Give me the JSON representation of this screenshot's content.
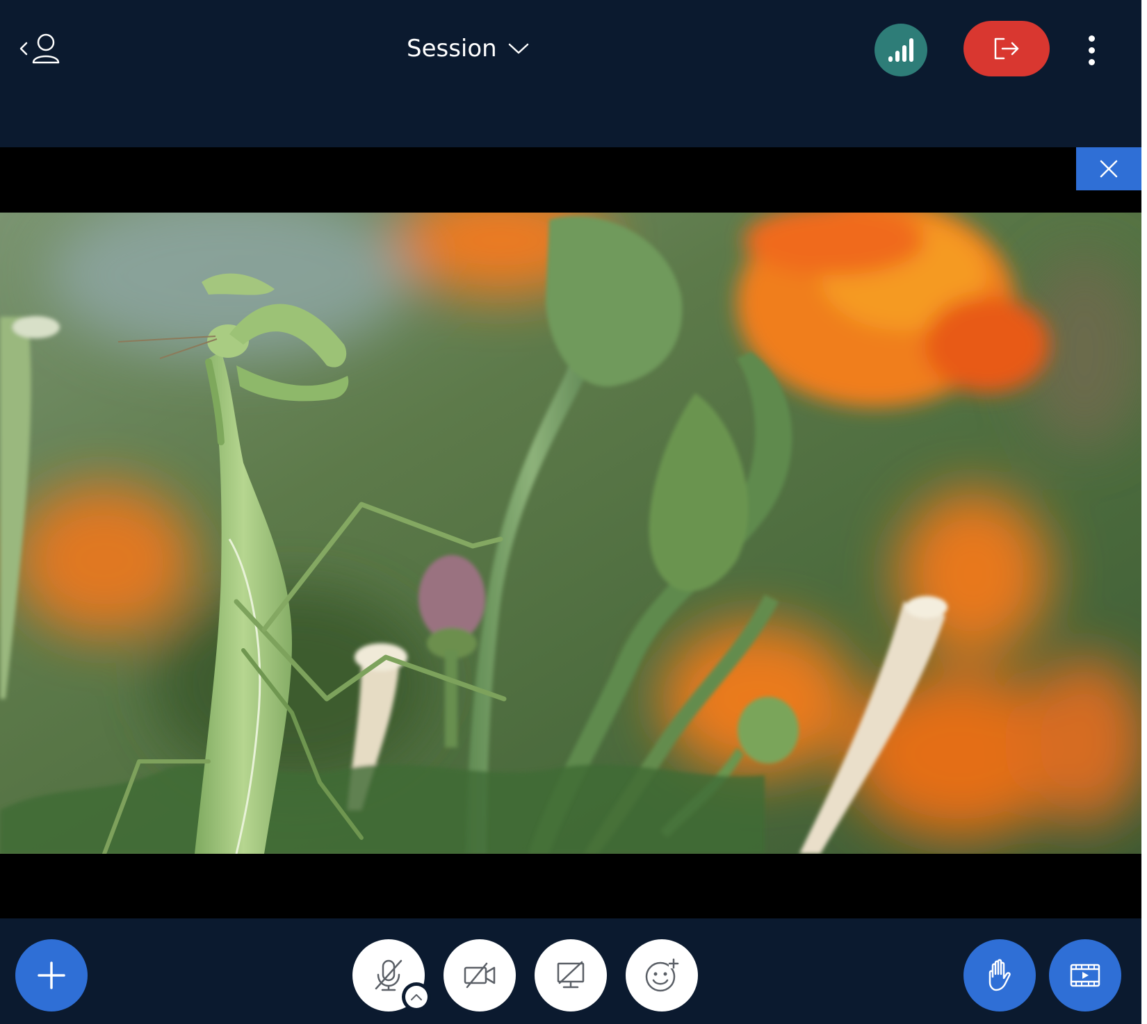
{
  "header": {
    "session_title": "Session"
  },
  "icons": {
    "user": "user-back-icon",
    "session_dropdown": "chevron-down-icon",
    "connection": "signal-bars-icon",
    "leave": "leave-session-icon",
    "more": "more-vertical-icon",
    "close_video": "close-icon",
    "add": "plus-icon",
    "mic": "mic-muted-icon",
    "mic_options": "chevron-up-icon",
    "camera": "camera-off-icon",
    "screen_share": "screen-share-off-icon",
    "reactions": "emoji-add-icon",
    "raise_hand": "hand-icon",
    "share_video": "video-player-icon"
  },
  "colors": {
    "background": "#0b1a2f",
    "signal_button": "#2e7d78",
    "leave_button": "#d93730",
    "primary_blue": "#2f6fd6",
    "white": "#ffffff"
  }
}
